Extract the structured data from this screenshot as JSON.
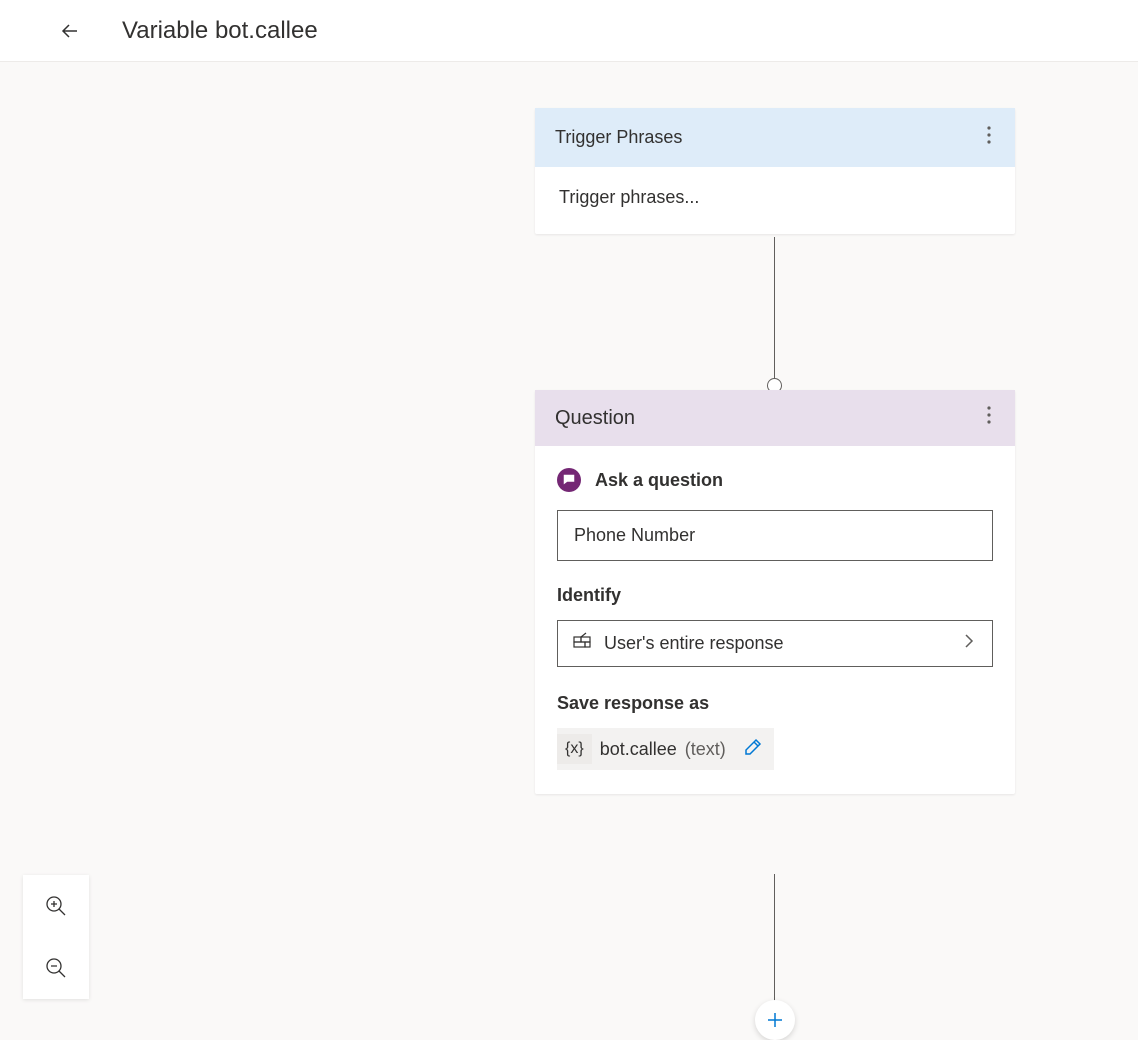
{
  "header": {
    "title": "Variable bot.callee"
  },
  "trigger_node": {
    "header": "Trigger Phrases",
    "body": "Trigger phrases..."
  },
  "question_node": {
    "header": "Question",
    "ask_label": "Ask a question",
    "question_value": "Phone Number",
    "identify_label": "Identify",
    "identify_value": "User's entire response",
    "save_label": "Save response as",
    "variable": {
      "icon": "{x}",
      "name": "bot.callee",
      "type": "(text)"
    }
  }
}
